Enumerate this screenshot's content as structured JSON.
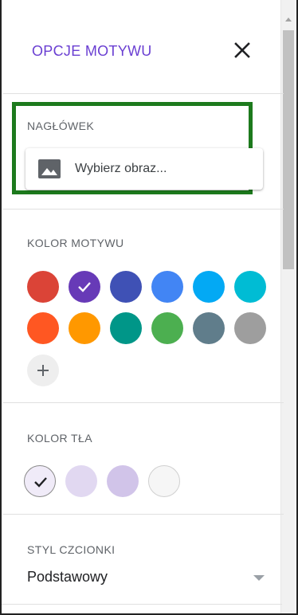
{
  "panel": {
    "title": "OPCJE MOTYWU",
    "close_icon": "close-icon"
  },
  "header_section": {
    "label": "NAGŁÓWEK",
    "pick_image_label": "Wybierz obraz...",
    "pick_image_icon": "image-icon"
  },
  "theme_color": {
    "label": "KOLOR MOTYWU",
    "swatches": [
      {
        "color": "#db4437",
        "selected": false
      },
      {
        "color": "#673ab7",
        "selected": true
      },
      {
        "color": "#3f51b5",
        "selected": false
      },
      {
        "color": "#4285f4",
        "selected": false
      },
      {
        "color": "#03a9f4",
        "selected": false
      },
      {
        "color": "#00bcd4",
        "selected": false
      },
      {
        "color": "#ff5722",
        "selected": false
      },
      {
        "color": "#ff9800",
        "selected": false
      },
      {
        "color": "#009688",
        "selected": false
      },
      {
        "color": "#4caf50",
        "selected": false
      },
      {
        "color": "#607d8b",
        "selected": false
      },
      {
        "color": "#9e9e9e",
        "selected": false
      }
    ],
    "add_icon": "plus-icon"
  },
  "background_color": {
    "label": "KOLOR TŁA",
    "swatches": [
      {
        "color": "#f0ebf8",
        "selected": true
      },
      {
        "color": "#e1d8f1",
        "selected": false
      },
      {
        "color": "#d1c4e9",
        "selected": false
      },
      {
        "color": "#f6f6f6",
        "selected": false
      }
    ]
  },
  "font_style": {
    "label": "STYL CZCIONKI",
    "value": "Podstawowy",
    "arrow_icon": "dropdown-arrow-icon"
  }
}
